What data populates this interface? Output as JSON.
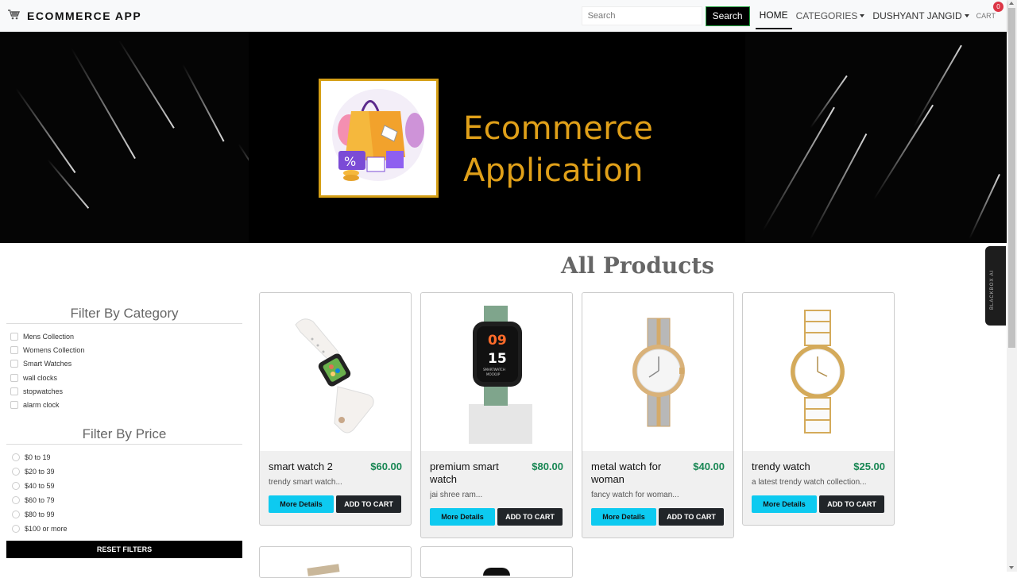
{
  "navbar": {
    "brand": "ECOMMERCE APP",
    "search_placeholder": "Search",
    "search_button": "Search",
    "links": {
      "home": "HOME",
      "categories": "CATEGORIES",
      "user": "DUSHYANT JANGID",
      "cart": "CART"
    },
    "cart_count": "0"
  },
  "banner": {
    "title_line1": "Ecommerce",
    "title_line2": "Application"
  },
  "main": {
    "heading": "All Products"
  },
  "sidebar": {
    "category_title": "Filter By Category",
    "categories": [
      "Mens Collection",
      "Womens Collection",
      "Smart Watches",
      "wall clocks",
      "stopwatches",
      "alarm clock"
    ],
    "price_title": "Filter By Price",
    "prices": [
      "$0 to 19",
      "$20 to 39",
      "$40 to 59",
      "$60 to 79",
      "$80 to 99",
      "$100 or more"
    ],
    "reset_button": "RESET FILTERS"
  },
  "products": [
    {
      "name": "smart watch 2",
      "price": "$60.00",
      "desc": "trendy smart watch...",
      "more": "More Details",
      "add": "ADD TO CART"
    },
    {
      "name": "premium smart watch",
      "price": "$80.00",
      "desc": "jai shree ram...",
      "more": "More Details",
      "add": "ADD TO CART"
    },
    {
      "name": "metal watch for woman",
      "price": "$40.00",
      "desc": "fancy watch for woman...",
      "more": "More Details",
      "add": "ADD TO CART"
    },
    {
      "name": "trendy watch",
      "price": "$25.00",
      "desc": "a latest trendy watch collection...",
      "more": "More Details",
      "add": "ADD TO CART"
    }
  ],
  "widget": {
    "label": "BLACKBOX AI"
  }
}
